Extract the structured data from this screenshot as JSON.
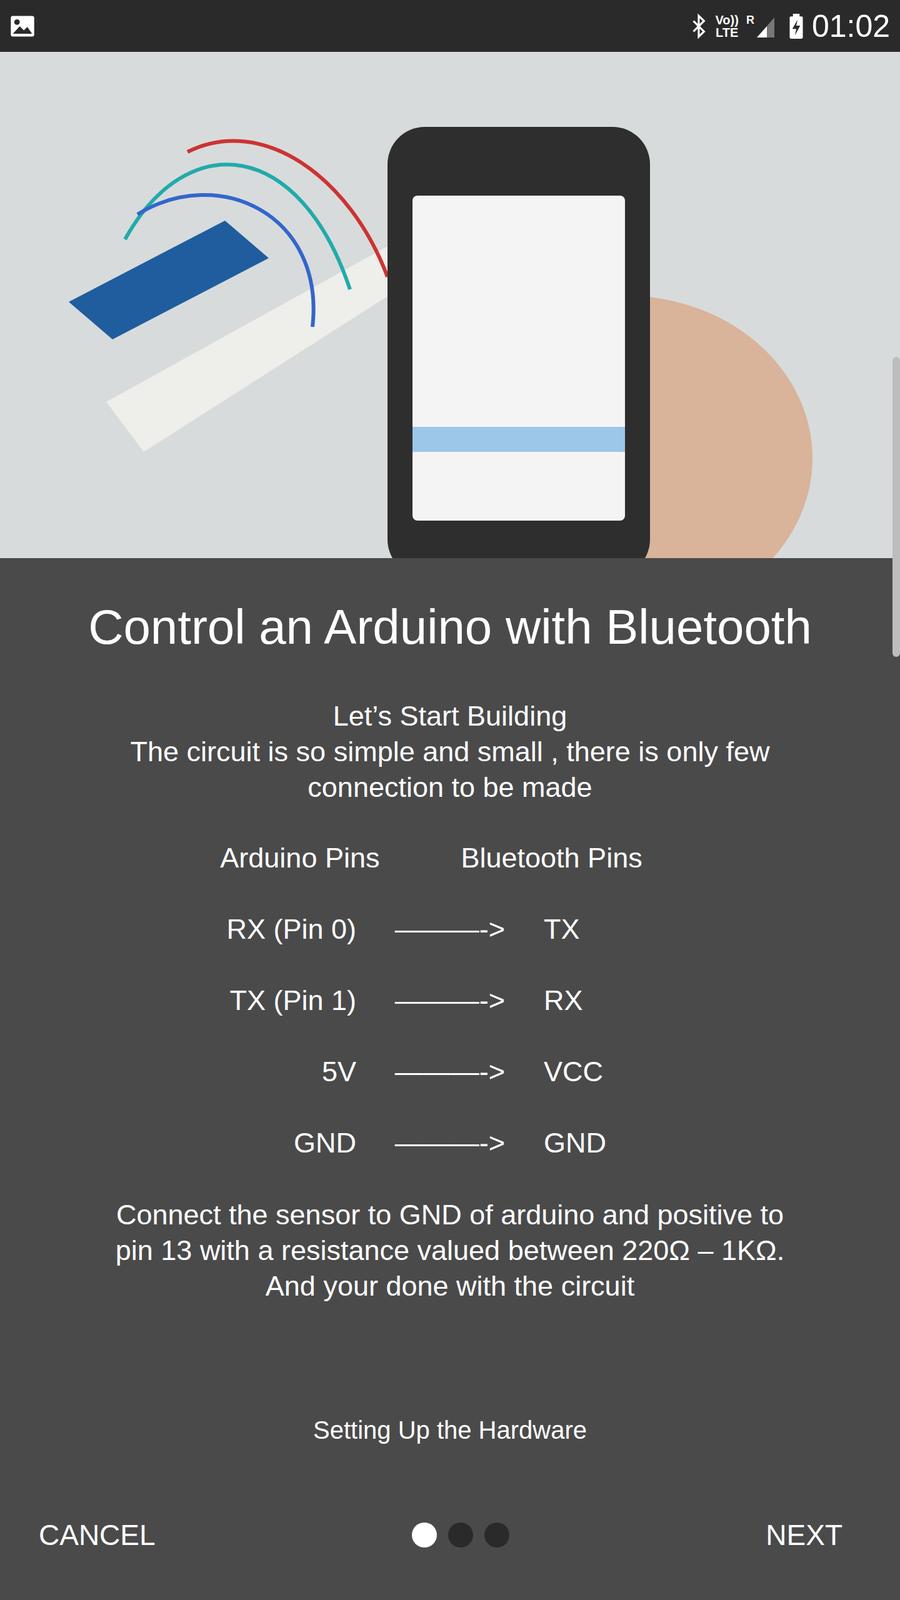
{
  "status_bar": {
    "network": "Vo))",
    "network_sub": "LTE",
    "roaming": "R",
    "time": "01:02"
  },
  "title": "Control an Arduino with Bluetooth",
  "intro": {
    "heading": "Let’s Start Building",
    "lines": [
      "The circuit is so simple and small , there is only few",
      "connection to be made"
    ]
  },
  "pin_table": {
    "columns": [
      "Arduino Pins",
      "Bluetooth Pins"
    ],
    "rows": [
      {
        "arduino": "RX (Pin 0)",
        "arrow": "———->",
        "bluetooth": "TX"
      },
      {
        "arduino": "TX (Pin 1)",
        "arrow": "———->",
        "bluetooth": "RX"
      },
      {
        "arduino": "5V",
        "arrow": "———->",
        "bluetooth": "VCC"
      },
      {
        "arduino": "GND",
        "arrow": "———->",
        "bluetooth": "GND"
      }
    ]
  },
  "note": [
    "Connect the sensor to GND of arduino and positive to",
    "pin 13 with a resistance valued between 220Ω – 1KΩ.",
    "And your done with the circuit"
  ],
  "step_label": "Setting Up the Hardware",
  "pager": {
    "dots": [
      {
        "selected": true
      },
      {
        "selected": false
      },
      {
        "selected": false
      }
    ]
  },
  "buttons": {
    "cancel": "CANCEL",
    "next": "NEXT"
  }
}
